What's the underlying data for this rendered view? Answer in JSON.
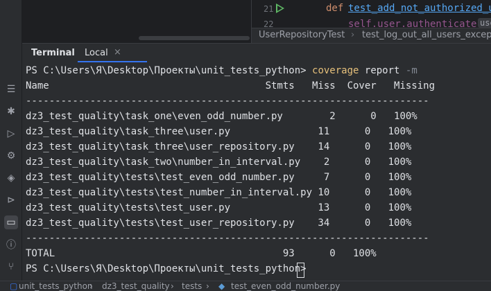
{
  "editor": {
    "line_numbers": [
      "21",
      "22"
    ],
    "code_line_1": {
      "keyword": "def",
      "func": "test_add_not_authorized_us"
    },
    "code_line_2": {
      "text": "self.user.authenticate(",
      "hint": "use"
    },
    "breadcrumb": [
      "UserRepositoryTest",
      "test_log_out_all_users_except"
    ]
  },
  "terminal": {
    "tabs": [
      {
        "label": "Terminal"
      },
      {
        "label": "Local",
        "close": "×"
      }
    ],
    "prompt": "PS C:\\Users\\Я\\Desktop\\Проекты\\unit_tests_python>",
    "command": "coverage",
    "command_args": "report",
    "command_flag": "-m",
    "header": "Name                                     Stmts   Miss  Cover   Missing",
    "separator": "---------------------------------------------------------------------",
    "rows": [
      "dz3_test_quality\\task_one\\even_odd_number.py        2      0   100%",
      "dz3_test_quality\\task_three\\user.py               11      0   100%",
      "dz3_test_quality\\task_three\\user_repository.py    14      0   100%",
      "dz3_test_quality\\task_two\\number_in_interval.py    2      0   100%",
      "dz3_test_quality\\tests\\test_even_odd_number.py     7      0   100%",
      "dz3_test_quality\\tests\\test_number_in_interval.py 10      0   100%",
      "dz3_test_quality\\tests\\test_user.py               13      0   100%",
      "dz3_test_quality\\tests\\test_user_repository.py    34      0   100%"
    ],
    "total": "TOTAL                                       93      0   100%"
  },
  "statusbar": {
    "crumbs": [
      "unit_tests_python",
      "dz3_test_quality",
      "tests",
      "test_even_odd_number.py"
    ]
  },
  "sidebar_icons": [
    "structure-icon",
    "debug-icon",
    "run-icon",
    "python-console-icon",
    "layers-icon",
    "services-icon",
    "terminal-icon",
    "problems-icon",
    "git-icon"
  ],
  "colors": {
    "accent": "#3574f0",
    "command": "#e6c07b",
    "keyword": "#cf8e6d",
    "function": "#56a8f5"
  }
}
